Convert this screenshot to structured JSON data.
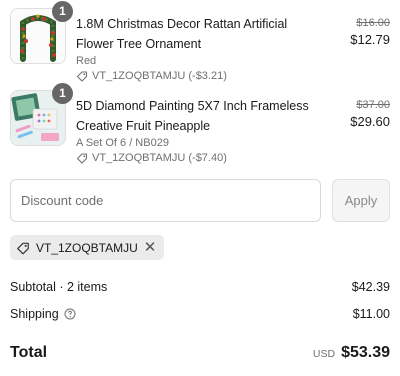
{
  "items": [
    {
      "quantity": "1",
      "title": "1.8M Christmas Decor Rattan Artificial Flower Tree Ornament",
      "variant": "Red",
      "discount_text": "VT_1ZOQBTAMJU (-$3.21)",
      "original_price": "$16.00",
      "price": "$12.79",
      "thumbnail_icon": "garland-image"
    },
    {
      "quantity": "1",
      "title": "5D Diamond Painting 5X7 Inch Frameless Creative Fruit Pineapple",
      "variant": "A Set Of 6 / NB029",
      "discount_text": "VT_1ZOQBTAMJU (-$7.40)",
      "original_price": "$37.00",
      "price": "$29.60",
      "thumbnail_icon": "diamond-painting-image"
    }
  ],
  "discount": {
    "placeholder": "Discount code",
    "apply_label": "Apply",
    "applied_code": "VT_1ZOQBTAMJU"
  },
  "summary": {
    "subtotal_label": "Subtotal · 2 items",
    "subtotal_value": "$42.39",
    "shipping_label": "Shipping",
    "shipping_value": "$11.00",
    "total_label": "Total",
    "currency": "USD",
    "total_value": "$53.39"
  }
}
